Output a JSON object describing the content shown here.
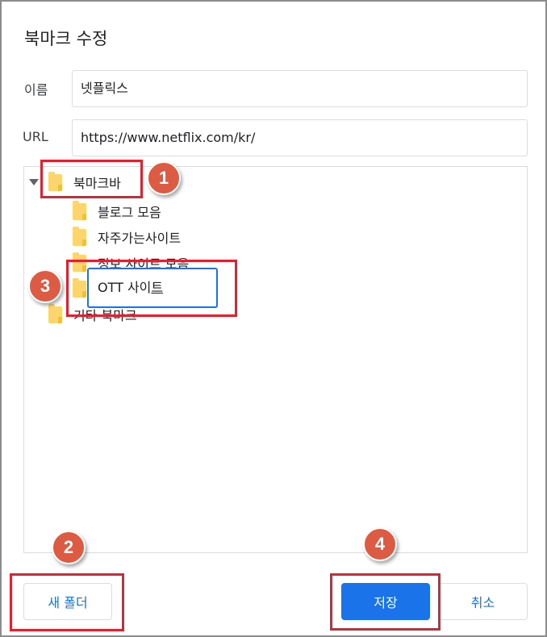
{
  "dialog": {
    "title": "북마크 수정",
    "name_label": "이름",
    "name_value": "넷플릭스",
    "url_label": "URL",
    "url_value": "https://www.netflix.com/kr/"
  },
  "tree": {
    "root": {
      "label": "북마크바",
      "expanded": true
    },
    "children": [
      {
        "label": "블로그 모음"
      },
      {
        "label": "자주가는사이트"
      },
      {
        "label": "정보 사이트 모음"
      }
    ],
    "rename": {
      "value_prefix": "OTT 사이",
      "value_caret": "트"
    },
    "other": {
      "label": "기타 북마크"
    }
  },
  "buttons": {
    "new_folder": "새 폴더",
    "save": "저장",
    "cancel": "취소"
  },
  "annotations": {
    "badges": [
      "1",
      "2",
      "3",
      "4"
    ],
    "badge_color": "#dd5b42",
    "box_color": "#e0212f"
  },
  "colors": {
    "accent": "#1a73e8",
    "folder": "#fcd66c"
  }
}
